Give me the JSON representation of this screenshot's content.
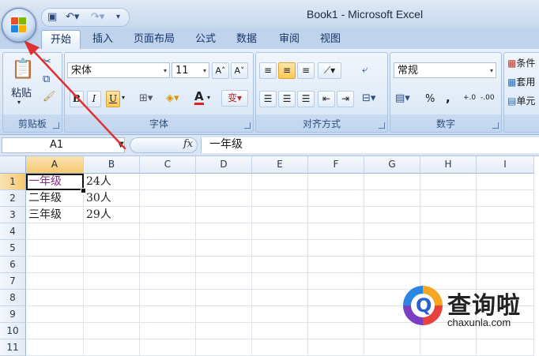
{
  "title_bar": {
    "title": "Book1 - Microsoft Excel"
  },
  "quick_access": {
    "icons": [
      "save-icon",
      "undo-icon",
      "redo-icon",
      "customize-icon"
    ]
  },
  "tabs": [
    {
      "label": "开始",
      "active": true
    },
    {
      "label": "插入"
    },
    {
      "label": "页面布局"
    },
    {
      "label": "公式"
    },
    {
      "label": "数据"
    },
    {
      "label": "审阅"
    },
    {
      "label": "视图"
    }
  ],
  "ribbon": {
    "clipboard": {
      "label": "剪贴板",
      "paste_label": "粘贴"
    },
    "font": {
      "label": "字体",
      "font_name": "宋体",
      "font_size": "11",
      "bold": "B",
      "italic": "I",
      "underline": "U",
      "grow": "A˄",
      "shrink": "A˅",
      "font_color_letter": "A",
      "phonetic": "变"
    },
    "alignment": {
      "label": "对齐方式"
    },
    "number": {
      "label": "数字",
      "format": "常规",
      "percent": "%",
      "comma": ",",
      "inc_decimal": "+.0",
      "dec_decimal": "-.00"
    },
    "styles": {
      "conditional": "条件",
      "table": "套用",
      "cell": "单元"
    }
  },
  "formula_bar": {
    "name_box": "A1",
    "fx": "fx",
    "content": "一年级"
  },
  "grid": {
    "columns": [
      "A",
      "B",
      "C",
      "D",
      "E",
      "F",
      "G",
      "H",
      "I"
    ],
    "rows": [
      "1",
      "2",
      "3",
      "4",
      "5",
      "6",
      "7",
      "8",
      "9",
      "10",
      "11"
    ],
    "cells": [
      {
        "ref": "A1",
        "value": "一年级"
      },
      {
        "ref": "B1",
        "value": "24人"
      },
      {
        "ref": "A2",
        "value": "二年级"
      },
      {
        "ref": "B2",
        "value": "30人"
      },
      {
        "ref": "A3",
        "value": "三年级"
      },
      {
        "ref": "B3",
        "value": "29人"
      }
    ]
  },
  "colors": {
    "arrow": "#e03030",
    "selected_header": "#f5c86e",
    "a1_text": "#8b2a8b"
  },
  "watermark": {
    "brand": "查询啦",
    "url": "chaxunla.com",
    "icon_letter": "Q"
  }
}
